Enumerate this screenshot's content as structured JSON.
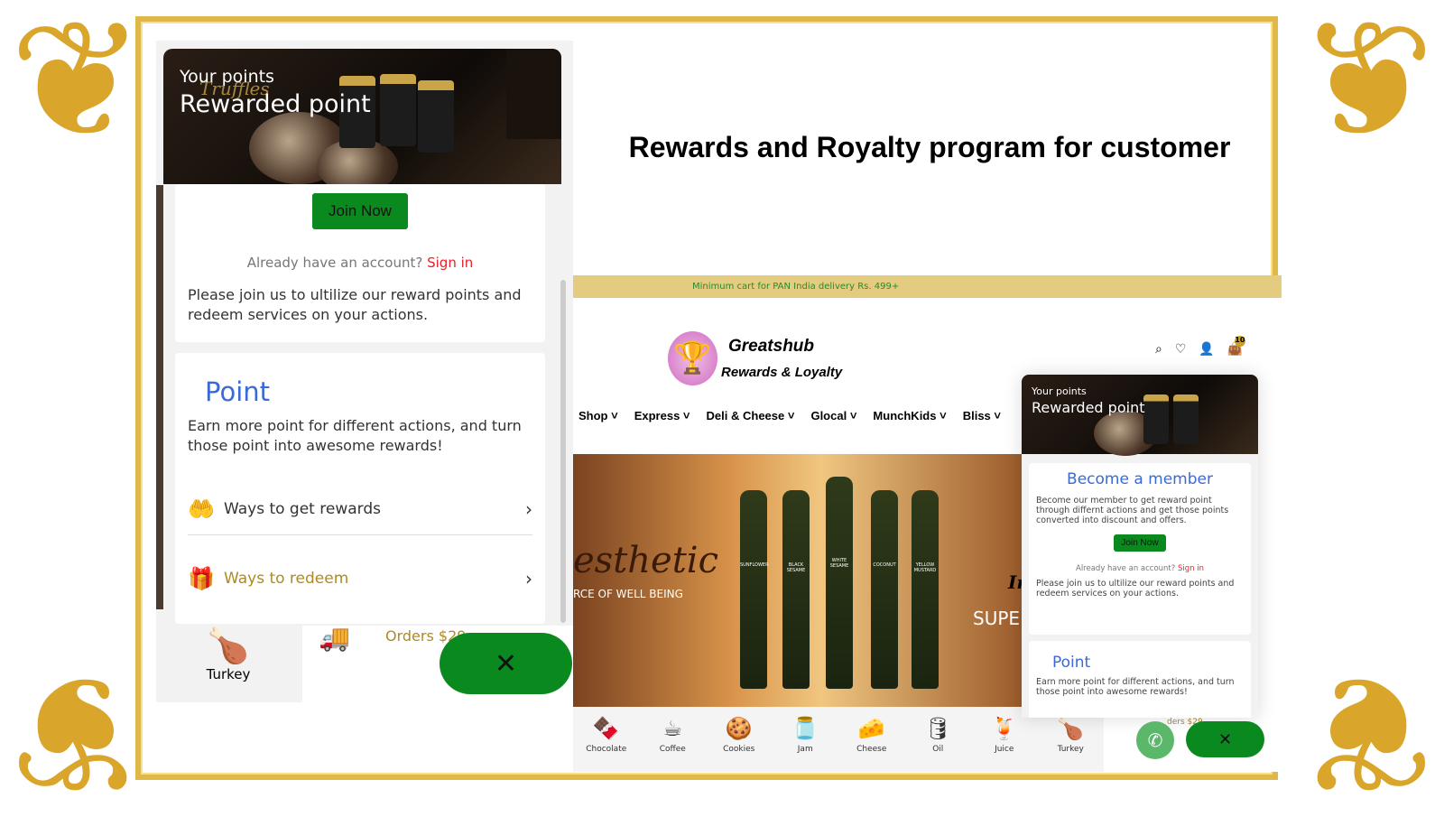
{
  "headline": "Rewards and Royalty program for customer",
  "left_panel": {
    "hero": {
      "your_points": "Your points",
      "rewarded": "Rewarded point",
      "script": "Truffles"
    },
    "join_label": "Join Now",
    "already": "Already have an account?",
    "sign_in": "Sign in",
    "please_join": "Please join us to ultilize our reward points and redeem services on your actions.",
    "point_title": "Point",
    "point_desc": "Earn more point for different actions, and turn those point into awesome rewards!",
    "ways_get": "Ways to get rewards",
    "ways_redeem": "Ways to redeem",
    "behind": {
      "turkey": "Turkey",
      "orders": "Orders $29"
    }
  },
  "site": {
    "strip": "Minimum cart for PAN India delivery Rs. 499+",
    "brand": "Greatshub",
    "brand_sub": "Rewards & Loyalty",
    "cart_count": "10",
    "nav": [
      "Shop",
      "Express",
      "Deli & Cheese",
      "Glocal",
      "MunchKids",
      "Bliss"
    ],
    "banner": {
      "script": "esthetic",
      "tag": "RCE OF WELL BEING",
      "right1": "In",
      "right2": "SUPE",
      "labels": [
        "SUNFLOWER",
        "BLACK SESAME",
        "WHITE SESAME",
        "COCONUT",
        "YELLOW MUSTARD"
      ]
    },
    "categories": [
      "Chocolate",
      "Coffee",
      "Cookies",
      "Jam",
      "Cheese",
      "Oil",
      "Juice",
      "Turkey"
    ],
    "popup": {
      "your_points": "Your points",
      "rewarded": "Rewarded point",
      "member_title": "Become a member",
      "member_desc": "Become our member to get reward point through differnt actions and get those points converted into discount and offers.",
      "join_label": "Join Now",
      "already": "Already have an account?",
      "sign_in": "Sign in",
      "please_join": "Please join us to ultilize our reward points and redeem services on your actions.",
      "point_title": "Point",
      "point_desc": "Earn more point for different actions, and turn those point into awesome rewards!",
      "behind_orders": "ders $29"
    }
  },
  "colors": {
    "gold": "#e0b84a",
    "green": "#0a8a1e",
    "link_red": "#e8202b",
    "title_blue": "#3a6ad8",
    "strip": "#e3cb80"
  }
}
